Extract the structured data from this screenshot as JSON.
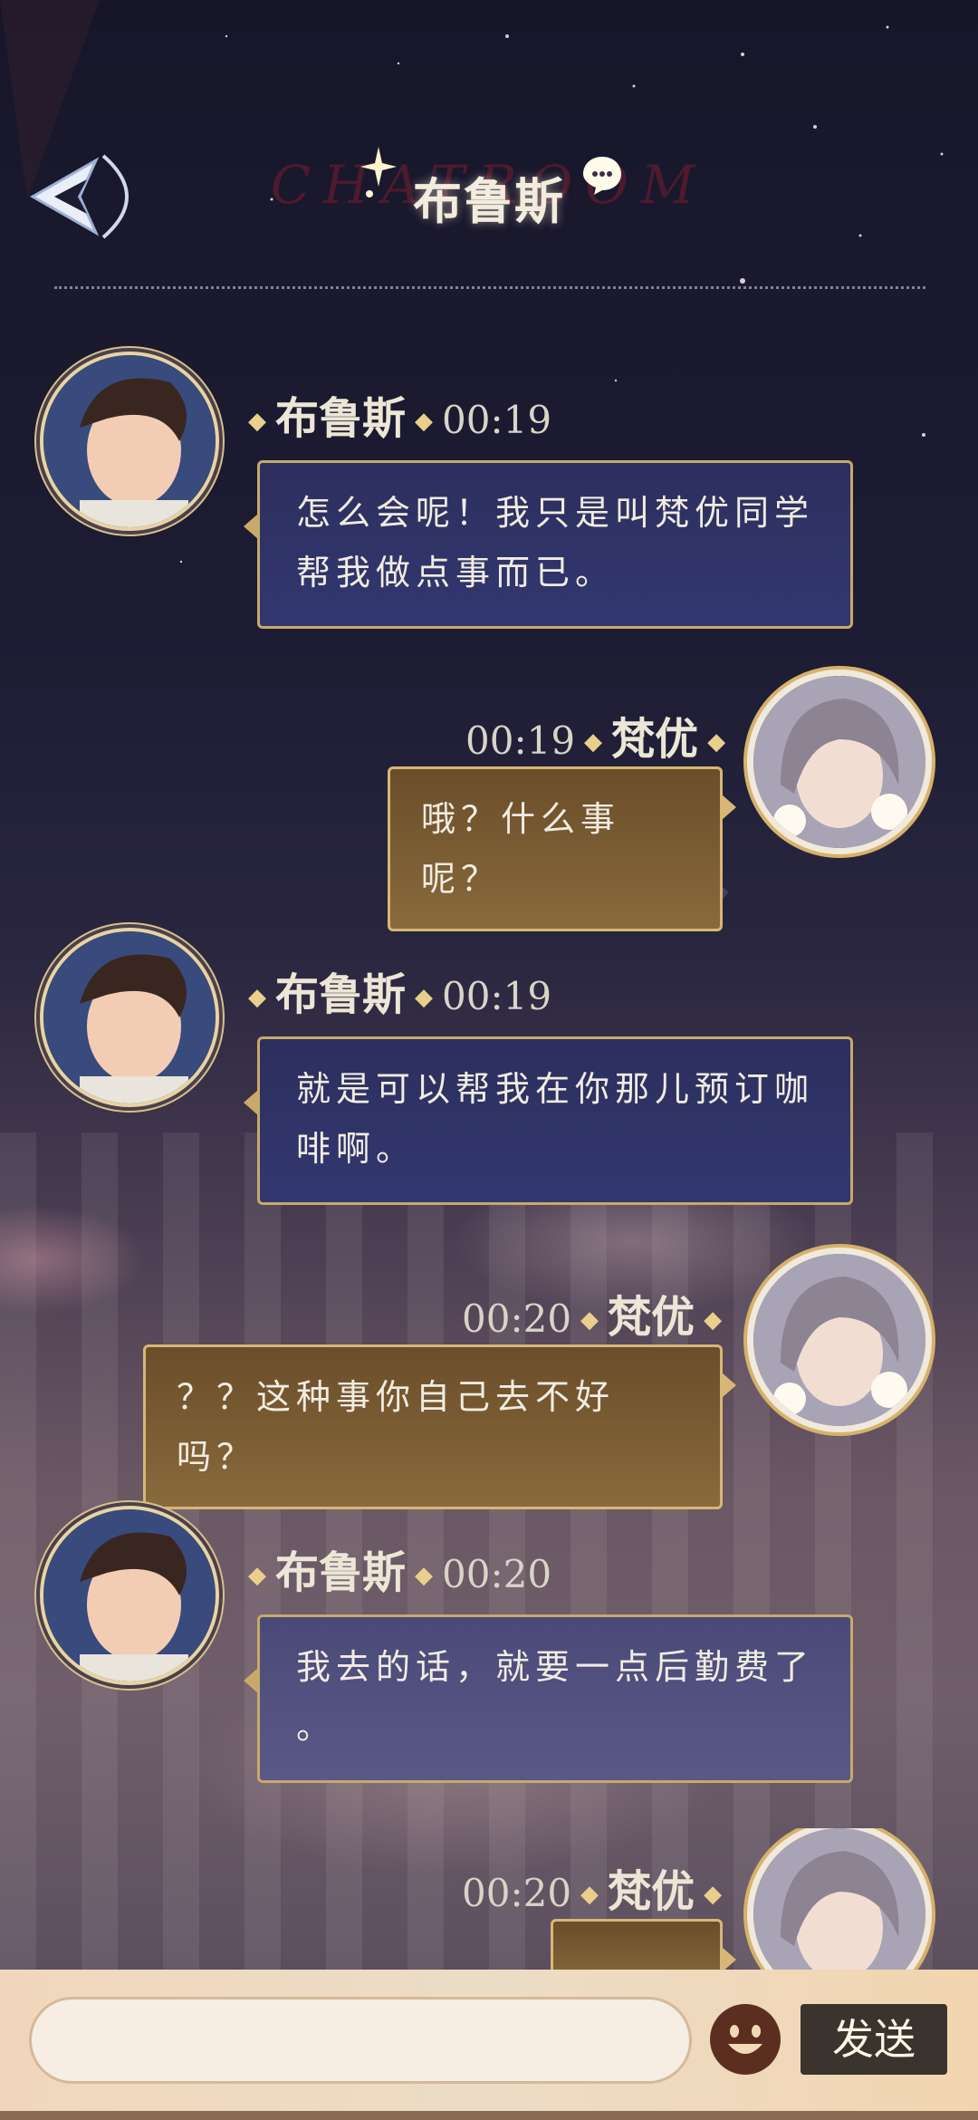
{
  "header": {
    "watermark": "CHATROOM",
    "title": "布鲁斯"
  },
  "messages": [
    {
      "side": "left",
      "name": "布鲁斯",
      "time": "00:19",
      "lines": [
        "怎么会呢！我只是叫梵优同学",
        "帮我做点事而已。"
      ]
    },
    {
      "side": "right",
      "name": "梵优",
      "time": "00:19",
      "lines": [
        "哦？什么事呢？"
      ]
    },
    {
      "side": "left",
      "name": "布鲁斯",
      "time": "00:19",
      "lines": [
        "就是可以帮我在你那儿预订咖",
        "啡啊。"
      ]
    },
    {
      "side": "right",
      "name": "梵优",
      "time": "00:20",
      "lines": [
        "？？这种事你自己去不好吗？"
      ]
    },
    {
      "side": "left",
      "name": "布鲁斯",
      "time": "00:20",
      "lines": [
        "我去的话，就要一点后勤费了",
        "。"
      ]
    },
    {
      "side": "right",
      "name": "梵优",
      "time": "00:20",
      "lines": [
        ""
      ]
    }
  ],
  "input": {
    "placeholder": "",
    "send_label": "发送"
  },
  "colors": {
    "blue_bubble": "#2c2f5d",
    "gold_bubble": "#7a5c32",
    "bubble_border": "#c8a96a",
    "accent": "#e8cf8c"
  },
  "icons": {
    "back": "back-arrow-icon",
    "title_bubble": "chat-bubble-icon",
    "emoji": "emoji-face-icon"
  }
}
